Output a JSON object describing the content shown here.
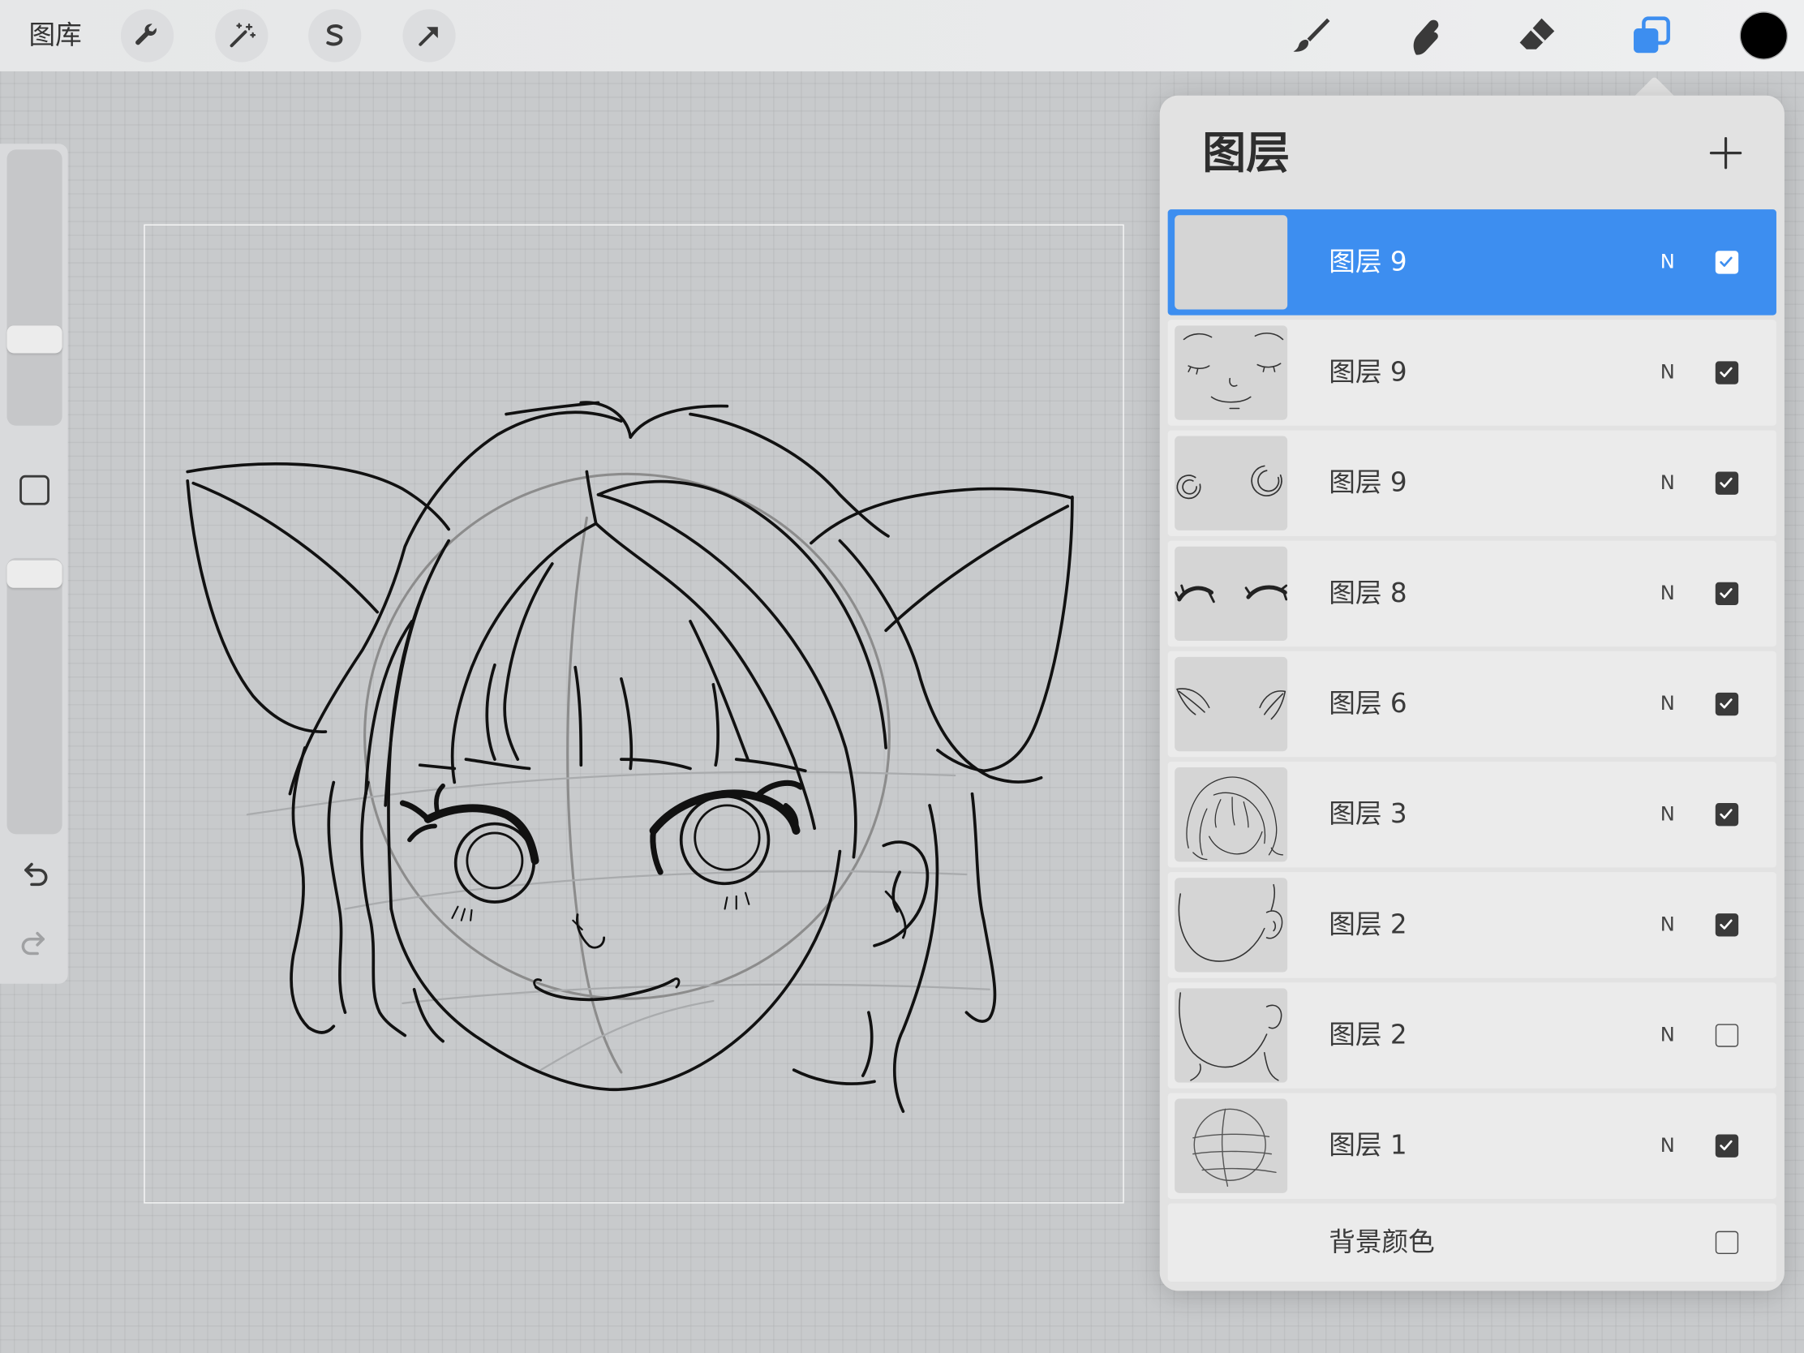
{
  "toolbar": {
    "gallery_label": "图库",
    "left_icons": [
      "wrench-icon",
      "magic-wand-icon",
      "selection-icon",
      "transform-arrow-icon"
    ],
    "right_icons": [
      "brush-icon",
      "smudge-icon",
      "eraser-icon",
      "layers-icon"
    ],
    "active_tool": "layers-icon",
    "current_color": "#000000"
  },
  "sidebar": {
    "brush_size_level": 0.29,
    "opacity_level": 0.99,
    "icons": [
      "square-icon",
      "undo-icon",
      "redo-icon"
    ]
  },
  "layers_panel": {
    "title": "图层",
    "add_icon": "plus-icon",
    "layers": [
      {
        "name": "图层 9",
        "blend": "N",
        "visible": true,
        "selected": true
      },
      {
        "name": "图层 9",
        "blend": "N",
        "visible": true,
        "selected": false
      },
      {
        "name": "图层 9",
        "blend": "N",
        "visible": true,
        "selected": false
      },
      {
        "name": "图层 8",
        "blend": "N",
        "visible": true,
        "selected": false
      },
      {
        "name": "图层 6",
        "blend": "N",
        "visible": true,
        "selected": false
      },
      {
        "name": "图层 3",
        "blend": "N",
        "visible": true,
        "selected": false
      },
      {
        "name": "图层 2",
        "blend": "N",
        "visible": true,
        "selected": false
      },
      {
        "name": "图层 2",
        "blend": "N",
        "visible": false,
        "selected": false
      },
      {
        "name": "图层 1",
        "blend": "N",
        "visible": true,
        "selected": false
      }
    ],
    "background_layer": {
      "label": "背景颜色",
      "visible": false
    }
  },
  "colors": {
    "accent": "#3d8ef0",
    "toolbar_icon": "#3a3a3a"
  }
}
